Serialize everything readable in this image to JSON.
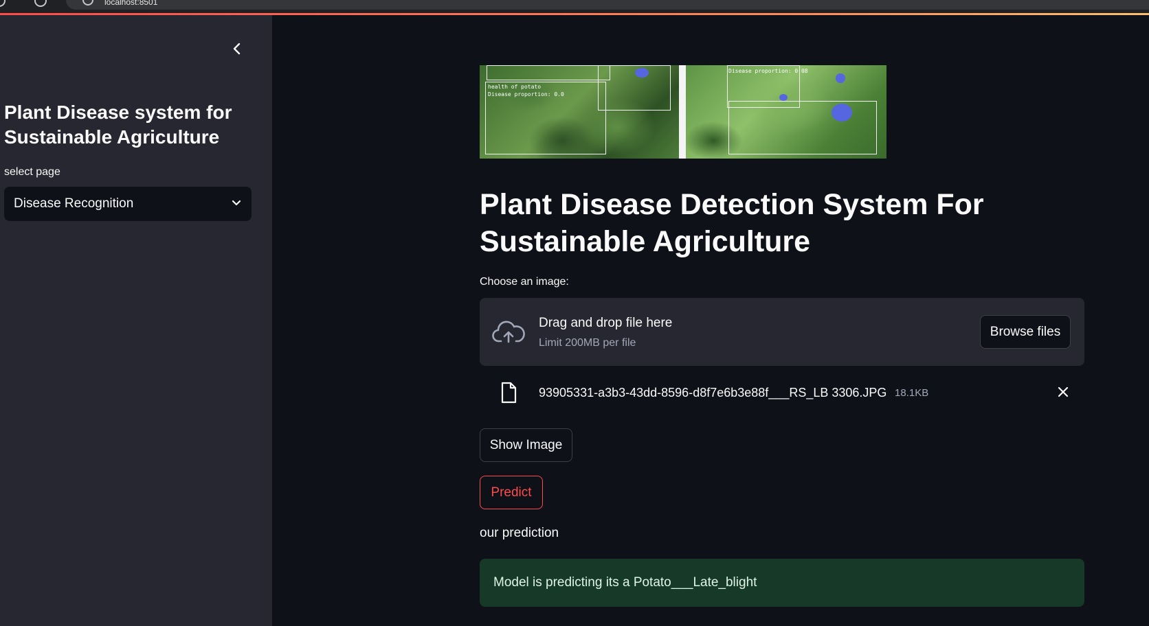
{
  "browser": {
    "url_text": "localhost:8501"
  },
  "sidebar": {
    "title": "Plant Disease system for Sustainable Agriculture",
    "select_label": "select page",
    "select_value": "Disease Recognition"
  },
  "banner": {
    "left_label_line1": "health of potato",
    "left_label_line2": "Disease proportion: 0.0",
    "right_label_line2": "Disease proportion: 0.08"
  },
  "main": {
    "title": "Plant Disease Detection System For Sustainable Agriculture",
    "uploader": {
      "label": "Choose an image:",
      "drop_title": "Drag and drop file here",
      "drop_sub": "Limit 200MB per file",
      "browse_label": "Browse files"
    },
    "file": {
      "name": "93905331-a3b3-43dd-8596-d8f7e6b3e88f___RS_LB 3306.JPG",
      "size": "18.1KB"
    },
    "show_image_label": "Show Image",
    "predict_label": "Predict",
    "prediction_heading": "our prediction",
    "prediction_result": "Model is predicting its a Potato___Late_blight"
  },
  "colors": {
    "background": "#0e1117",
    "sidebar": "#262730",
    "accent": "#ff4b4b",
    "success_bg": "#173928"
  },
  "icons": [
    "back-icon",
    "reload-icon",
    "site-info-icon",
    "chevron-left-icon",
    "chevron-down-icon",
    "cloud-upload-icon",
    "file-icon",
    "close-icon"
  ]
}
